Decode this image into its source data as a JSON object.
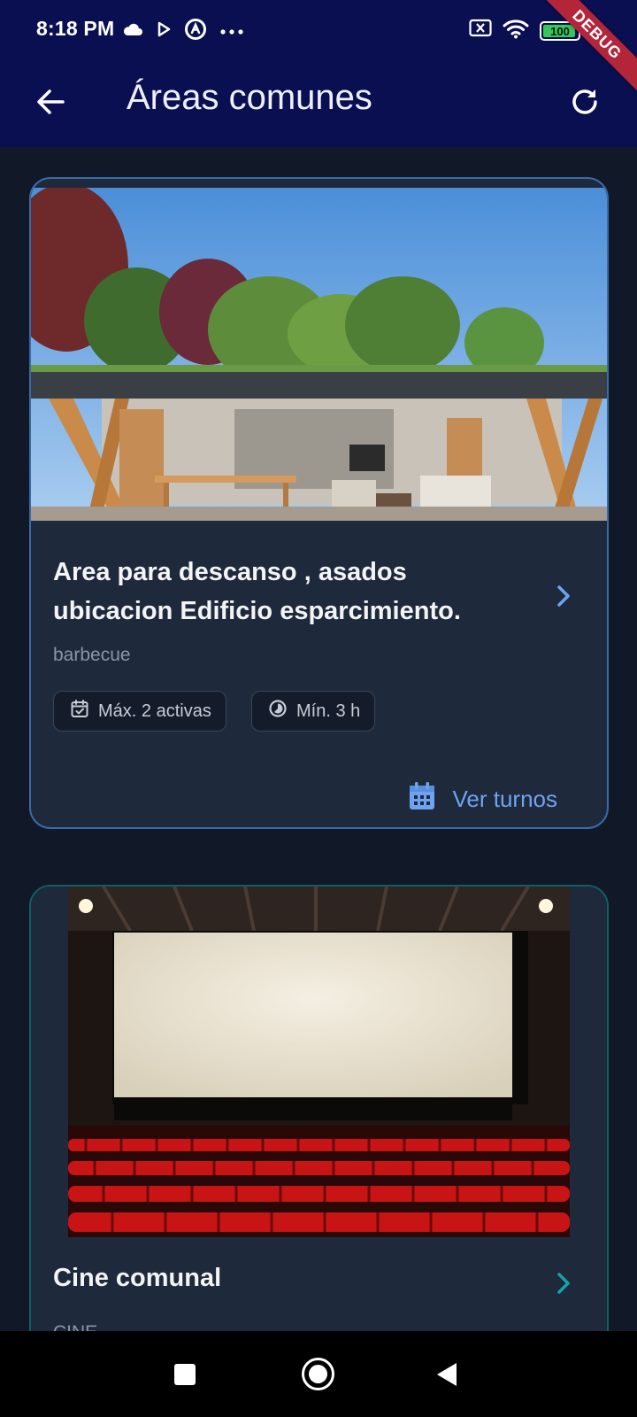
{
  "status_bar": {
    "time": "8:18 PM",
    "battery_level": "100",
    "icons": [
      "cloud-icon",
      "play-icon",
      "at-sign-icon",
      "more-dots-icon",
      "no-sim-icon",
      "wifi-icon",
      "battery-icon",
      "charging-icon"
    ]
  },
  "debug_banner": "DEBUG",
  "app_bar": {
    "title": "Áreas comunes",
    "back_icon": "arrow-back-icon",
    "refresh_icon": "refresh-icon"
  },
  "cards": [
    {
      "title": "Area para descanso , asados ubicacion Edificio esparcimiento.",
      "subtitle": "barbecue",
      "chip_max": "Máx. 2 activas",
      "chip_min": "Mín. 3 h",
      "action": "Ver turnos",
      "border_color": "#3b6aa8"
    },
    {
      "title": "Cine comunal",
      "subtitle": "CINE",
      "border_color": "#0f5f63"
    }
  ],
  "colors": {
    "app_bar": "#0a0f52",
    "background": "#111827",
    "card": "#1e293b",
    "accent": "#6fa3f0",
    "accent_teal": "#14a3a8",
    "debug": "#b3263a"
  }
}
